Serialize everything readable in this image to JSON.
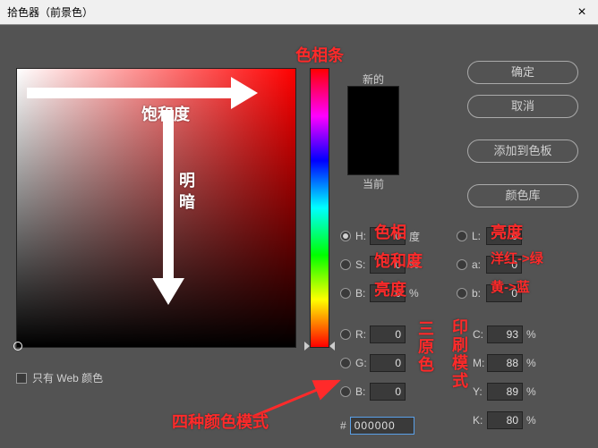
{
  "window": {
    "title": "拾色器（前景色）"
  },
  "buttons": {
    "ok": "确定",
    "cancel": "取消",
    "add_swatch": "添加到色板",
    "color_libs": "颜色库"
  },
  "swatch": {
    "new_label": "新的",
    "current_label": "当前"
  },
  "web_only": {
    "label": "只有 Web 颜色"
  },
  "fields": {
    "H": {
      "label": "H:",
      "value": "0",
      "unit": "度"
    },
    "S": {
      "label": "S:",
      "value": "0",
      "unit": "%"
    },
    "Bv": {
      "label": "B:",
      "value": "0",
      "unit": "%"
    },
    "R": {
      "label": "R:",
      "value": "0"
    },
    "G": {
      "label": "G:",
      "value": "0"
    },
    "Bc": {
      "label": "B:",
      "value": "0"
    },
    "L": {
      "label": "L:",
      "value": "0"
    },
    "a": {
      "label": "a:",
      "value": "0"
    },
    "b": {
      "label": "b:",
      "value": "0"
    },
    "C": {
      "label": "C:",
      "value": "93",
      "unit": "%"
    },
    "M": {
      "label": "M:",
      "value": "88",
      "unit": "%"
    },
    "Y": {
      "label": "Y:",
      "value": "89",
      "unit": "%"
    },
    "K": {
      "label": "K:",
      "value": "80",
      "unit": "%"
    }
  },
  "hex": {
    "label": "#",
    "value": "000000"
  },
  "annotations": {
    "hue_strip": "色相条",
    "saturation": "饱和度",
    "value_l1": "明",
    "value_l2": "暗",
    "hue_field": "色相",
    "sat_field": "饱和度",
    "bri_field": "亮度",
    "L_field": "亮度",
    "a_field": "洋红->绿",
    "b_field": "黄->蓝",
    "rgb": "三原色",
    "cmyk": "印刷模式",
    "modes": "四种颜色模式"
  }
}
